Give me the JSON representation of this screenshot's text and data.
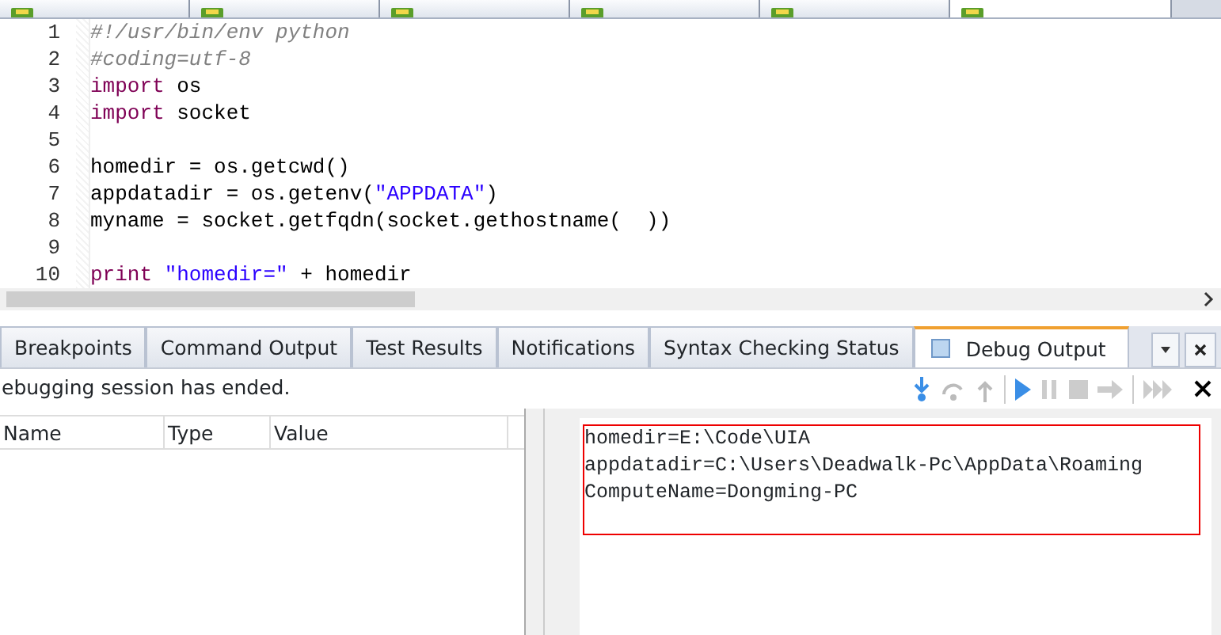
{
  "file_tabs": [
    {
      "selected": false
    },
    {
      "selected": false
    },
    {
      "selected": false
    },
    {
      "selected": false
    },
    {
      "selected": false
    },
    {
      "selected": true
    }
  ],
  "code_lines": [
    {
      "number": "1",
      "tokens": [
        {
          "kind": "comment",
          "text": "#!/usr/bin/env python"
        }
      ]
    },
    {
      "number": "2",
      "tokens": [
        {
          "kind": "comment",
          "text": "#coding=utf-8"
        }
      ]
    },
    {
      "number": "3",
      "tokens": [
        {
          "kind": "keyword",
          "text": "import"
        },
        {
          "kind": "plain",
          "text": " os"
        }
      ]
    },
    {
      "number": "4",
      "tokens": [
        {
          "kind": "keyword",
          "text": "import"
        },
        {
          "kind": "plain",
          "text": " socket"
        }
      ]
    },
    {
      "number": "5"
    },
    {
      "number": "6",
      "tokens": [
        {
          "kind": "plain",
          "text": "homedir = os.getcwd()"
        }
      ]
    },
    {
      "number": "7",
      "tokens": [
        {
          "kind": "plain",
          "text": "appdatadir = os.getenv("
        },
        {
          "kind": "string",
          "text": "\"APPDATA\""
        },
        {
          "kind": "plain",
          "text": ")"
        }
      ]
    },
    {
      "number": "8",
      "tokens": [
        {
          "kind": "plain",
          "text": "myname = socket.getfqdn(socket.gethostname(  ))"
        }
      ]
    },
    {
      "number": "9"
    },
    {
      "number": "10",
      "tokens": [
        {
          "kind": "keyword",
          "text": "print"
        },
        {
          "kind": "string",
          "text": " \"homedir=\""
        },
        {
          "kind": "plain",
          "text": " + homedir"
        }
      ]
    }
  ],
  "panel_tabs": [
    {
      "label": "Breakpoints",
      "selected": false
    },
    {
      "label": "Command Output",
      "selected": false
    },
    {
      "label": "Test Results",
      "selected": false
    },
    {
      "label": "Notifications",
      "selected": false
    },
    {
      "label": "Syntax Checking Status",
      "selected": false
    },
    {
      "label": "Debug Output",
      "selected": true
    }
  ],
  "status": "ebugging session has ended.",
  "variables": {
    "columns": [
      "Name",
      "Type",
      "Value"
    ]
  },
  "output_lines": [
    "homedir=E:\\Code\\UIA",
    "appdatadir=C:\\Users\\Deadwalk-Pc\\AppData\\Roaming",
    "ComputeName=Dongming-PC"
  ]
}
